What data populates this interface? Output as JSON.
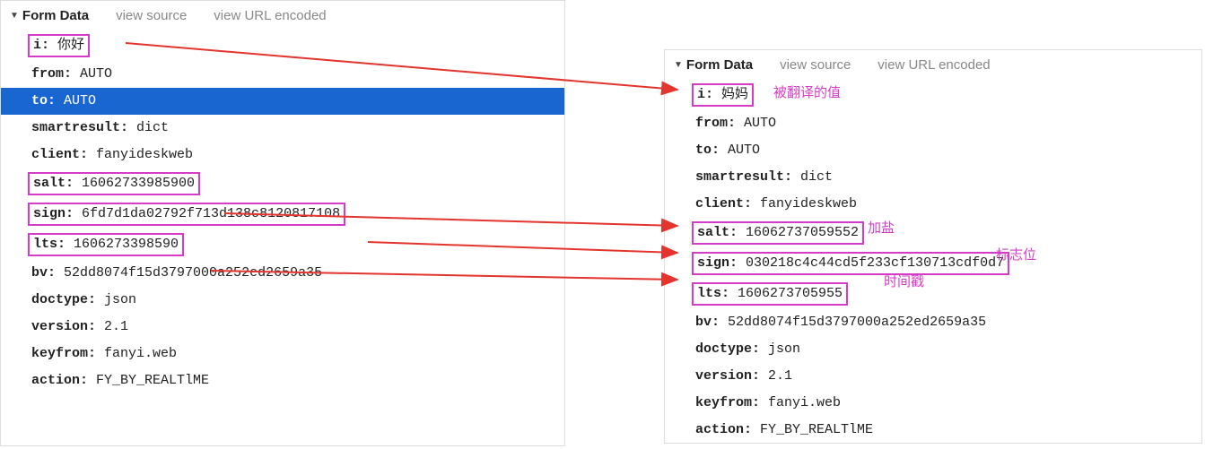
{
  "header": {
    "title": "Form Data",
    "view_source": "view source",
    "view_url_encoded": "view URL encoded"
  },
  "left": {
    "i": {
      "k": "i:",
      "v": "你好"
    },
    "from": {
      "k": "from:",
      "v": "AUTO"
    },
    "to": {
      "k": "to:",
      "v": "AUTO"
    },
    "smartresult": {
      "k": "smartresult:",
      "v": "dict"
    },
    "client": {
      "k": "client:",
      "v": "fanyideskweb"
    },
    "salt": {
      "k": "salt:",
      "v": "16062733985900"
    },
    "sign": {
      "k": "sign:",
      "v": "6fd7d1da02792f713d138c8120817108"
    },
    "lts": {
      "k": "lts:",
      "v": "1606273398590"
    },
    "bv": {
      "k": "bv:",
      "v": "52dd8074f15d3797000a252ed2659a35"
    },
    "doctype": {
      "k": "doctype:",
      "v": "json"
    },
    "version": {
      "k": "version:",
      "v": "2.1"
    },
    "keyfrom": {
      "k": "keyfrom:",
      "v": "fanyi.web"
    },
    "action": {
      "k": "action:",
      "v": "FY_BY_REALTlME"
    }
  },
  "right": {
    "i": {
      "k": "i:",
      "v": "妈妈"
    },
    "from": {
      "k": "from:",
      "v": "AUTO"
    },
    "to": {
      "k": "to:",
      "v": "AUTO"
    },
    "smartresult": {
      "k": "smartresult:",
      "v": "dict"
    },
    "client": {
      "k": "client:",
      "v": "fanyideskweb"
    },
    "salt": {
      "k": "salt:",
      "v": "16062737059552"
    },
    "sign": {
      "k": "sign:",
      "v": "030218c4c44cd5f233cf130713cdf0d7"
    },
    "lts": {
      "k": "lts:",
      "v": "1606273705955"
    },
    "bv": {
      "k": "bv:",
      "v": "52dd8074f15d3797000a252ed2659a35"
    },
    "doctype": {
      "k": "doctype:",
      "v": "json"
    },
    "version": {
      "k": "version:",
      "v": "2.1"
    },
    "keyfrom": {
      "k": "keyfrom:",
      "v": "fanyi.web"
    },
    "action": {
      "k": "action:",
      "v": "FY_BY_REALTlME"
    }
  },
  "annotations": {
    "translated": "被翻译的值",
    "salt": "加盐",
    "sign": "标志位",
    "lts": "时间戳"
  },
  "colors": {
    "highlight": "#d63cc7",
    "arrow": "#e3352e",
    "select": "#1a66d1"
  }
}
